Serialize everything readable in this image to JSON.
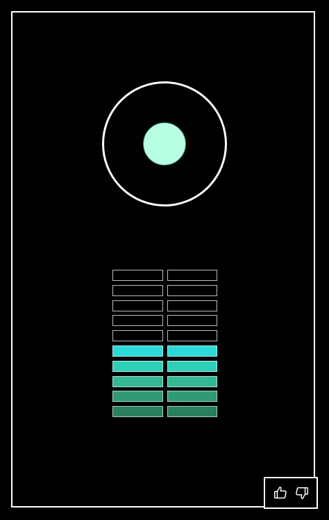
{
  "indicator": {
    "dot_color": "#b9ffe4",
    "ring_color": "#ffffff"
  },
  "level_meter": {
    "total_rows": 10,
    "active_rows": 5,
    "level_fraction": 0.5,
    "active_colors": [
      "#2bd9d9",
      "#2ecfb8",
      "#33b795",
      "#2f9a74",
      "#2a7f5f"
    ]
  },
  "feedback": {
    "thumbs_up_icon": "thumbs-up-icon",
    "thumbs_down_icon": "thumbs-down-icon"
  }
}
